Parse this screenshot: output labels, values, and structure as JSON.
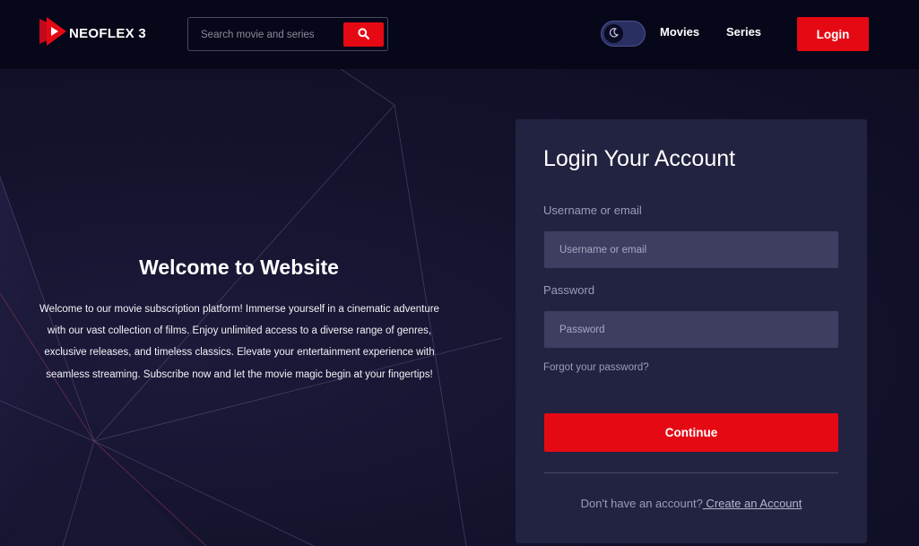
{
  "brand": {
    "name": "NEOFLEX 3",
    "logo_icon": "play-logo-icon",
    "logo_color": "#e50914"
  },
  "search": {
    "placeholder": "Search movie and series",
    "button_icon": "search-icon"
  },
  "theme_toggle": {
    "icon": "moon-icon",
    "mode": "dark"
  },
  "nav": {
    "movies": "Movies",
    "series": "Series",
    "login": "Login"
  },
  "hero": {
    "title": "Welcome to Website",
    "description": "Welcome to our movie subscription platform! Immerse yourself in a cinematic adventure with our vast collection of films. Enjoy unlimited access to a diverse range of genres, exclusive releases, and timeless classics. Elevate your entertainment experience with seamless streaming. Subscribe now and let the movie magic begin at your fingertips!"
  },
  "login_form": {
    "title": "Login Your Account",
    "username_label": "Username or email",
    "username_placeholder": "Username or email",
    "username_value": "",
    "password_label": "Password",
    "password_placeholder": "Password",
    "password_value": "",
    "forgot_link": "Forgot your password?",
    "submit_label": "Continue",
    "signup_prompt": "Don't have an account?",
    "signup_link": " Create an Account"
  },
  "colors": {
    "accent": "#e50914",
    "header_bg": "#07071a",
    "page_bg": "#12112a",
    "card_bg": "#222241",
    "input_bg": "#3e3e60"
  }
}
